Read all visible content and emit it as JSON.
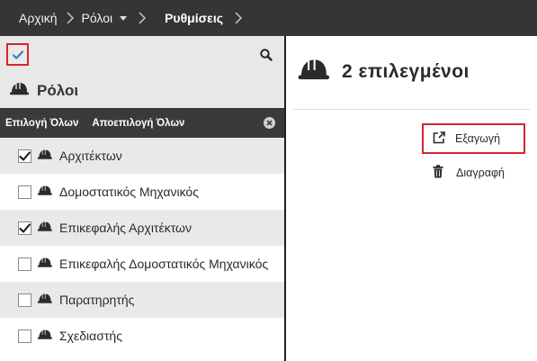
{
  "breadcrumb": {
    "items": [
      {
        "label": "Αρχική"
      },
      {
        "label": "Ρόλοι",
        "has_dropdown": true
      },
      {
        "label": "Ρυθμίσεις",
        "current": true
      }
    ]
  },
  "left_panel": {
    "section_title": "Ρόλοι",
    "select_all_label": "Επιλογή Όλων",
    "deselect_all_label": "Αποεπιλογή Όλων",
    "roles": [
      {
        "label": "Αρχιτέκτων",
        "checked": true
      },
      {
        "label": "Δομοστατικός Μηχανικός",
        "checked": false
      },
      {
        "label": "Επικεφαλής Αρχιτέκτων",
        "checked": true
      },
      {
        "label": "Επικεφαλής Δομοστατικός Μηχανικός",
        "checked": false
      },
      {
        "label": "Παρατηρητής",
        "checked": false
      },
      {
        "label": "Σχεδιαστής",
        "checked": false
      }
    ]
  },
  "right_panel": {
    "selected_count_label": "2 επιλεγμένοι",
    "export_label": "Εξαγωγή",
    "delete_label": "Διαγραφή"
  },
  "colors": {
    "topbar": "#353535",
    "highlight_border": "#d9232d",
    "row_alt": "#e9e9e9",
    "checkmark_blue": "#3b7fc4"
  }
}
